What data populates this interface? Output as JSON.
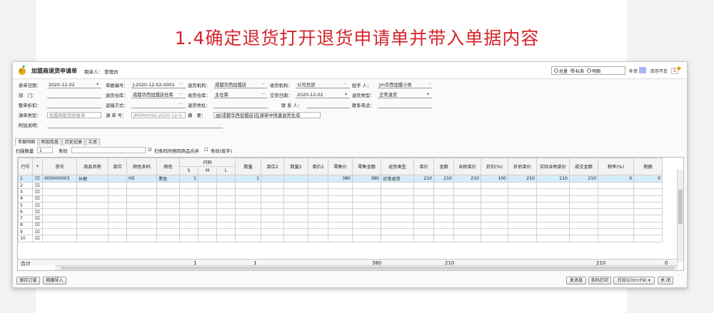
{
  "headline": "1.4确定退货打开退货申请单并带入单据内容",
  "window": {
    "title": "加盟商退货申请单",
    "maker_label": "制单人：",
    "maker": "管理员",
    "radios": [
      {
        "label": "总量",
        "checked": false
      },
      {
        "label": "标准",
        "checked": true
      },
      {
        "label": "明细",
        "checked": false
      }
    ],
    "supplement_label": "补货",
    "stock_short_label": "库存不足",
    "stock_short_value": "1",
    "supplement_color": "#a9b7ef",
    "stock_short_color": "#ffffff"
  },
  "form": {
    "date_label": "表单日期：",
    "date": "2020-12-02",
    "dept_label": "部　门：",
    "dept": "",
    "discount_label": "整单折扣：",
    "discount": "",
    "source_type_label": "源单类型：",
    "source_type": "加盟商配货验收单",
    "note_label": "附加说明：",
    "note": "",
    "bill_no_label": "单据编号：",
    "bill_no": "J-2020-12-02-0001",
    "out_wh_label": "退货仓库：",
    "out_wh": "成都华西加盟店仓库",
    "ship_label": "运输方式：",
    "ship": "",
    "source_no_label": "源 单 号：",
    "source_no": "JMSPHYSD-2020-12-0",
    "ret_org_label": "退货机构：",
    "ret_org": "成都华西加盟店",
    "recv_wh_label": "收货仓库：",
    "recv_wh": "主仓库",
    "ret_addr_label": "退货地址：",
    "ret_addr": "",
    "summary_label": "摘　要：",
    "summary": "由[成都华西加盟店]在源单中快速退货生成",
    "recv_org_label": "收货机构：",
    "recv_org": "公司总部",
    "deliver_date_label": "交货日期：",
    "deliver_date": "2020-12-02",
    "contact_label": "联 系 人：",
    "contact": "",
    "handler_label": "经手 人：",
    "handler": "jm华西加盟小吴",
    "ret_type_label": "退货类型：",
    "ret_type": "正常退货",
    "phone_label": "联系电话：",
    "phone": ""
  },
  "tabs": [
    "单据明细",
    "附加信息",
    "历史记录",
    "汇总"
  ],
  "scan": {
    "qty_label": "扫描数量",
    "qty": "1",
    "code_label": "条码",
    "code": "",
    "merge_label": "扫条码时相同商品合并",
    "merge_checked": true,
    "manual_label": "条码(按手)",
    "manual_checked": false
  },
  "table": {
    "size_group": "尺码",
    "headers": [
      "行号",
      "+",
      "货号",
      "商品名称",
      "单位",
      "颜色条码",
      "颜色",
      "S",
      "M",
      "L",
      "数量",
      "单位2",
      "数量2",
      "单价2",
      "零售价",
      "零售金额",
      "退货类型",
      "单价",
      "金额",
      "含税单价",
      "折扣(%)",
      "折后单价",
      "实际含税单价",
      "成交金额",
      "税率(%)",
      "税额"
    ],
    "rows": [
      [
        "1",
        "⌧",
        "000000003",
        "长裤",
        "",
        "HS",
        "黑色",
        "1",
        "",
        "",
        "1",
        "",
        "",
        "",
        "380",
        "380",
        "正常退货",
        "210",
        "210",
        "210",
        "100",
        "210",
        "210",
        "210",
        "0",
        "0"
      ],
      [
        "2",
        "⌧"
      ],
      [
        "3",
        "⌧"
      ],
      [
        "4",
        "⌧"
      ],
      [
        "5",
        "⌧"
      ],
      [
        "6",
        "⌧"
      ],
      [
        "7",
        "⌧"
      ],
      [
        "8",
        "⌧"
      ],
      [
        "9",
        "⌧"
      ],
      [
        "10",
        "⌧"
      ]
    ],
    "summary_label": "合计",
    "summary": {
      "s": "1",
      "qty": "1",
      "retail_amount": "380",
      "amount": "210",
      "deal_amount": "210",
      "tax": "0"
    }
  },
  "buttons": {
    "save": "保存订单",
    "detail_import": "明细导入",
    "send": "发消息",
    "barcode_print": "条码打印",
    "print": "打印(Ctrl+F9)",
    "close": "关 闭"
  }
}
